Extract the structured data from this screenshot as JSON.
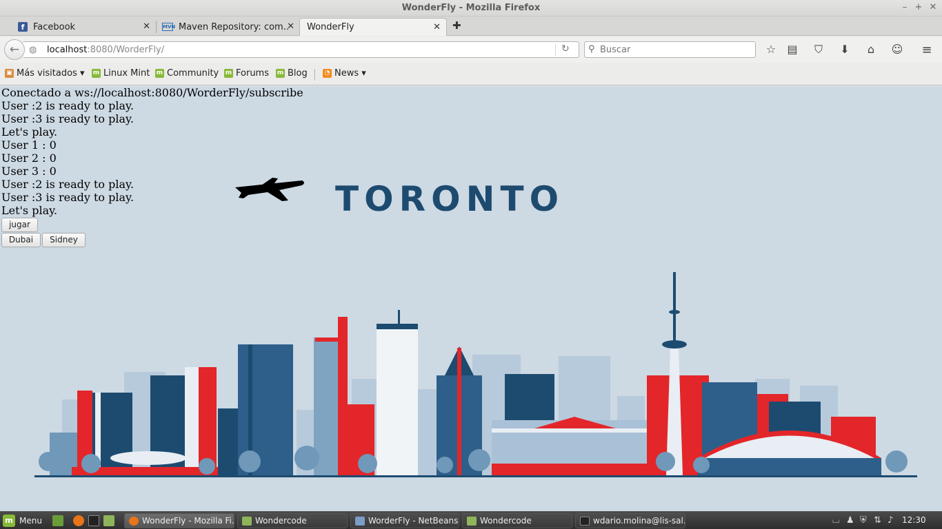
{
  "window": {
    "title": "WonderFly - Mozilla Firefox",
    "controls": [
      "–",
      "+",
      "✕"
    ]
  },
  "tabs": [
    {
      "label": "Facebook",
      "icon": "facebook-icon",
      "active": false
    },
    {
      "label": "Maven Repository: com...",
      "icon": "maven-icon",
      "active": false
    },
    {
      "label": "WonderFly",
      "icon": "",
      "active": true
    }
  ],
  "navbar": {
    "url_host": "localhost",
    "url_rest": ":8080/WorderFly/",
    "search_placeholder": "Buscar"
  },
  "bookmarks": [
    {
      "label": "Más visitados ▾",
      "icon": "most-visited-icon"
    },
    {
      "label": "Linux Mint",
      "icon": "mint-icon"
    },
    {
      "label": "Community",
      "icon": "mint-icon"
    },
    {
      "label": "Forums",
      "icon": "mint-icon"
    },
    {
      "label": "Blog",
      "icon": "mint-icon"
    },
    {
      "label": "News ▾",
      "icon": "rss-icon"
    }
  ],
  "page": {
    "log": [
      "Conectado a ws://localhost:8080/WorderFly/subscribe",
      "User :2 is ready to play.",
      "User :3 is ready to play.",
      "Let's play.",
      "User 1 : 0",
      "User 2 : 0",
      "User 3 : 0",
      "User :2 is ready to play.",
      "User :3 is ready to play.",
      "Let's play."
    ],
    "play_button": "jugar",
    "city_buttons": [
      "Dubai",
      "Sidney"
    ],
    "city_title": "TORONTO",
    "colors": {
      "background": "#cdd9e3",
      "navy": "#1d4b70",
      "red": "#e3262a",
      "steel": "#5f8bb0",
      "light": "#a9c1d6"
    }
  },
  "taskbar": {
    "menu_label": "Menu",
    "tasks": [
      {
        "label": "WonderFly - Mozilla Fi...",
        "active": true
      },
      {
        "label": "Wondercode",
        "active": false
      },
      {
        "label": "WorderFly - NetBeans...",
        "active": false
      },
      {
        "label": "Wondercode",
        "active": false
      },
      {
        "label": "wdario.molina@lis-sal...",
        "active": false
      }
    ],
    "clock": "12:30"
  }
}
